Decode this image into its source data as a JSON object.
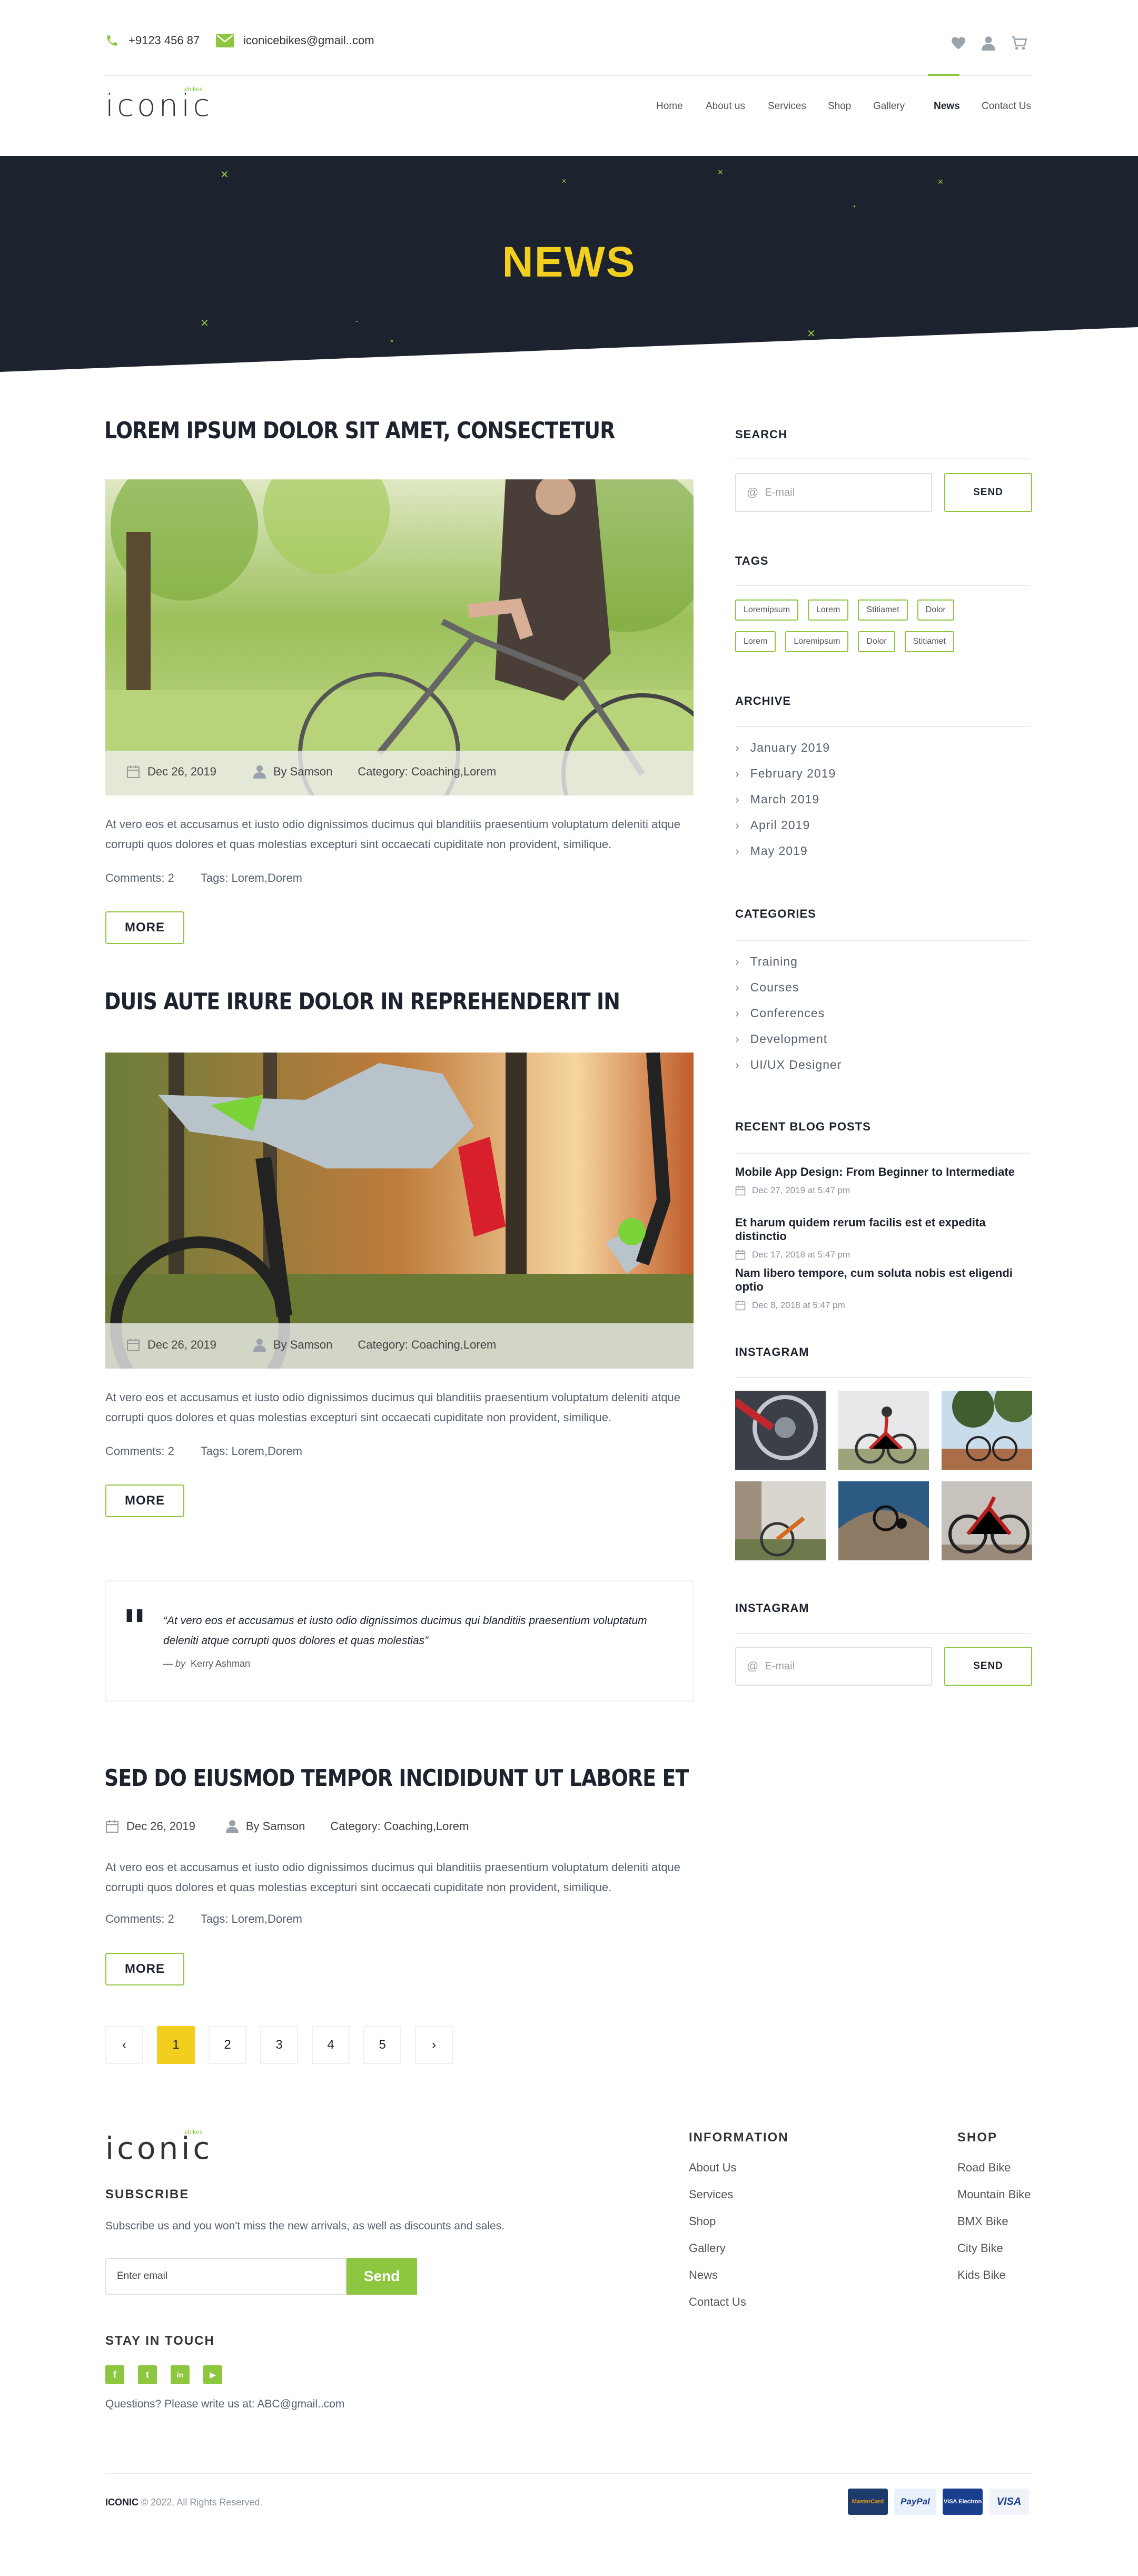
{
  "topbar": {
    "phone": "+9123 456 87",
    "email": "iconicebikes@gmail..com"
  },
  "brand": {
    "name": "iconic",
    "tagline": "ebikes"
  },
  "nav": {
    "items": [
      "Home",
      "About us",
      "Services",
      "Shop",
      "Gallery",
      "News",
      "Contact Us"
    ],
    "active": "News"
  },
  "hero": {
    "title": "NEWS"
  },
  "posts": [
    {
      "title": "LOREM IPSUM DOLOR SIT AMET, CONSECTETUR",
      "date": "Dec 26, 2019",
      "author": "By Samson",
      "category": "Category: Coaching,Lorem",
      "excerpt_line1": "At vero eos et accusamus et iusto odio dignissimos ducimus qui blanditiis praesentium voluptatum deleniti atque",
      "excerpt_line2": "corrupti quos dolores et quas molestias excepturi sint occaecati cupiditate non provident, similique.",
      "comments": "Comments: 2",
      "tags": "Tags: Lorem,Dorem",
      "more": "MORE"
    },
    {
      "title": "DUIS AUTE IRURE DOLOR IN REPREHENDERIT IN",
      "date": "Dec 26, 2019",
      "author": "By Samson",
      "category": "Category: Coaching,Lorem",
      "excerpt_line1": "At vero eos et accusamus et iusto odio dignissimos ducimus qui blanditiis praesentium voluptatum deleniti atque",
      "excerpt_line2": "corrupti quos dolores et quas molestias excepturi sint occaecati cupiditate non provident, similique.",
      "comments": "Comments: 2",
      "tags": "Tags: Lorem,Dorem",
      "more": "MORE"
    },
    {
      "title": "SED DO EIUSMOD TEMPOR INCIDIDUNT UT LABORE ET",
      "date": "Dec 26, 2019",
      "author": "By Samson",
      "category": "Category: Coaching,Lorem",
      "excerpt_line1": "At vero eos et accusamus et iusto odio dignissimos ducimus qui blanditiis praesentium voluptatum deleniti atque",
      "excerpt_line2": "corrupti quos dolores et quas molestias excepturi sint occaecati cupiditate non provident, similique.",
      "comments": "Comments: 2",
      "tags": "Tags: Lorem,Dorem",
      "more": "MORE"
    }
  ],
  "quote": {
    "text_line1": "“At vero eos et accusamus et iusto odio dignissimos ducimus qui blanditiis praesentium voluptatum",
    "text_line2": "deleniti atque corrupti quos dolores et quas molestias”",
    "by_prefix": "— by",
    "author": "Kerry Ashman"
  },
  "pagination": {
    "pages": [
      "1",
      "2",
      "3",
      "4",
      "5"
    ],
    "active": "1",
    "prev": "‹",
    "next": "›"
  },
  "sidebar": {
    "search": {
      "heading": "SEARCH",
      "placeholder": "E-mail",
      "button": "SEND"
    },
    "tags": {
      "heading": "TAGS",
      "row1": [
        "Loremipsum",
        "Lorem",
        "Stitiamet",
        "Dolor"
      ],
      "row2": [
        "Lorem",
        "Loremipsum",
        "Dolor",
        "Stitiamet"
      ]
    },
    "archive": {
      "heading": "ARCHIVE",
      "items": [
        "January 2019",
        "February 2019",
        "March 2019",
        "April 2019",
        "May 2019"
      ]
    },
    "categories": {
      "heading": "CATEGORIES",
      "items": [
        "Training",
        "Courses",
        "Conferences",
        "Development",
        "UI/UX Designer"
      ]
    },
    "recent": {
      "heading": "RECENT BLOG POSTS",
      "items": [
        {
          "title": "Mobile App Design: From Beginner to Intermediate",
          "date": "Dec 27, 2019 at 5:47 pm"
        },
        {
          "title": "Et harum quidem rerum facilis est et expedita distinctio",
          "date": "Dec 17, 2018 at 5:47 pm"
        },
        {
          "title": "Nam libero tempore, cum soluta nobis est eligendi optio",
          "date": "Dec 8, 2018 at 5:47 pm"
        }
      ]
    },
    "instagram": {
      "heading": "INSTAGRAM"
    },
    "instagram2": {
      "heading": "INSTAGRAM",
      "placeholder": "E-mail",
      "button": "SEND"
    }
  },
  "footer": {
    "subscribe_heading": "SUBSCRIBE",
    "subscribe_text": "Subscribe us and you won't miss the new arrivals, as well as discounts and sales.",
    "email_placeholder": "Enter email",
    "send": "Send",
    "stay_heading": "STAY IN TOUCH",
    "social": [
      "f",
      "t",
      "in",
      "▶"
    ],
    "questions": "Questions? Please write us at: ABC@gmail..com",
    "info_heading": "INFORMATION",
    "info_links": [
      "About Us",
      "Services",
      "Shop",
      "Gallery",
      "News",
      "Contact Us"
    ],
    "shop_heading": "SHOP",
    "shop_links": [
      "Road Bike",
      "Mountain Bike",
      "BMX Bike",
      "City Bike",
      "Kids Bike"
    ],
    "copyright_brand": "ICONIC",
    "copyright_text": " © 2022. All Rights Reserved.",
    "payments": [
      "MasterCard",
      "PayPal",
      "VISA Electron",
      "VISA"
    ]
  },
  "colors": {
    "accent": "#8dc63f",
    "yellow": "#f2cf1f",
    "dark": "#1c222e"
  }
}
